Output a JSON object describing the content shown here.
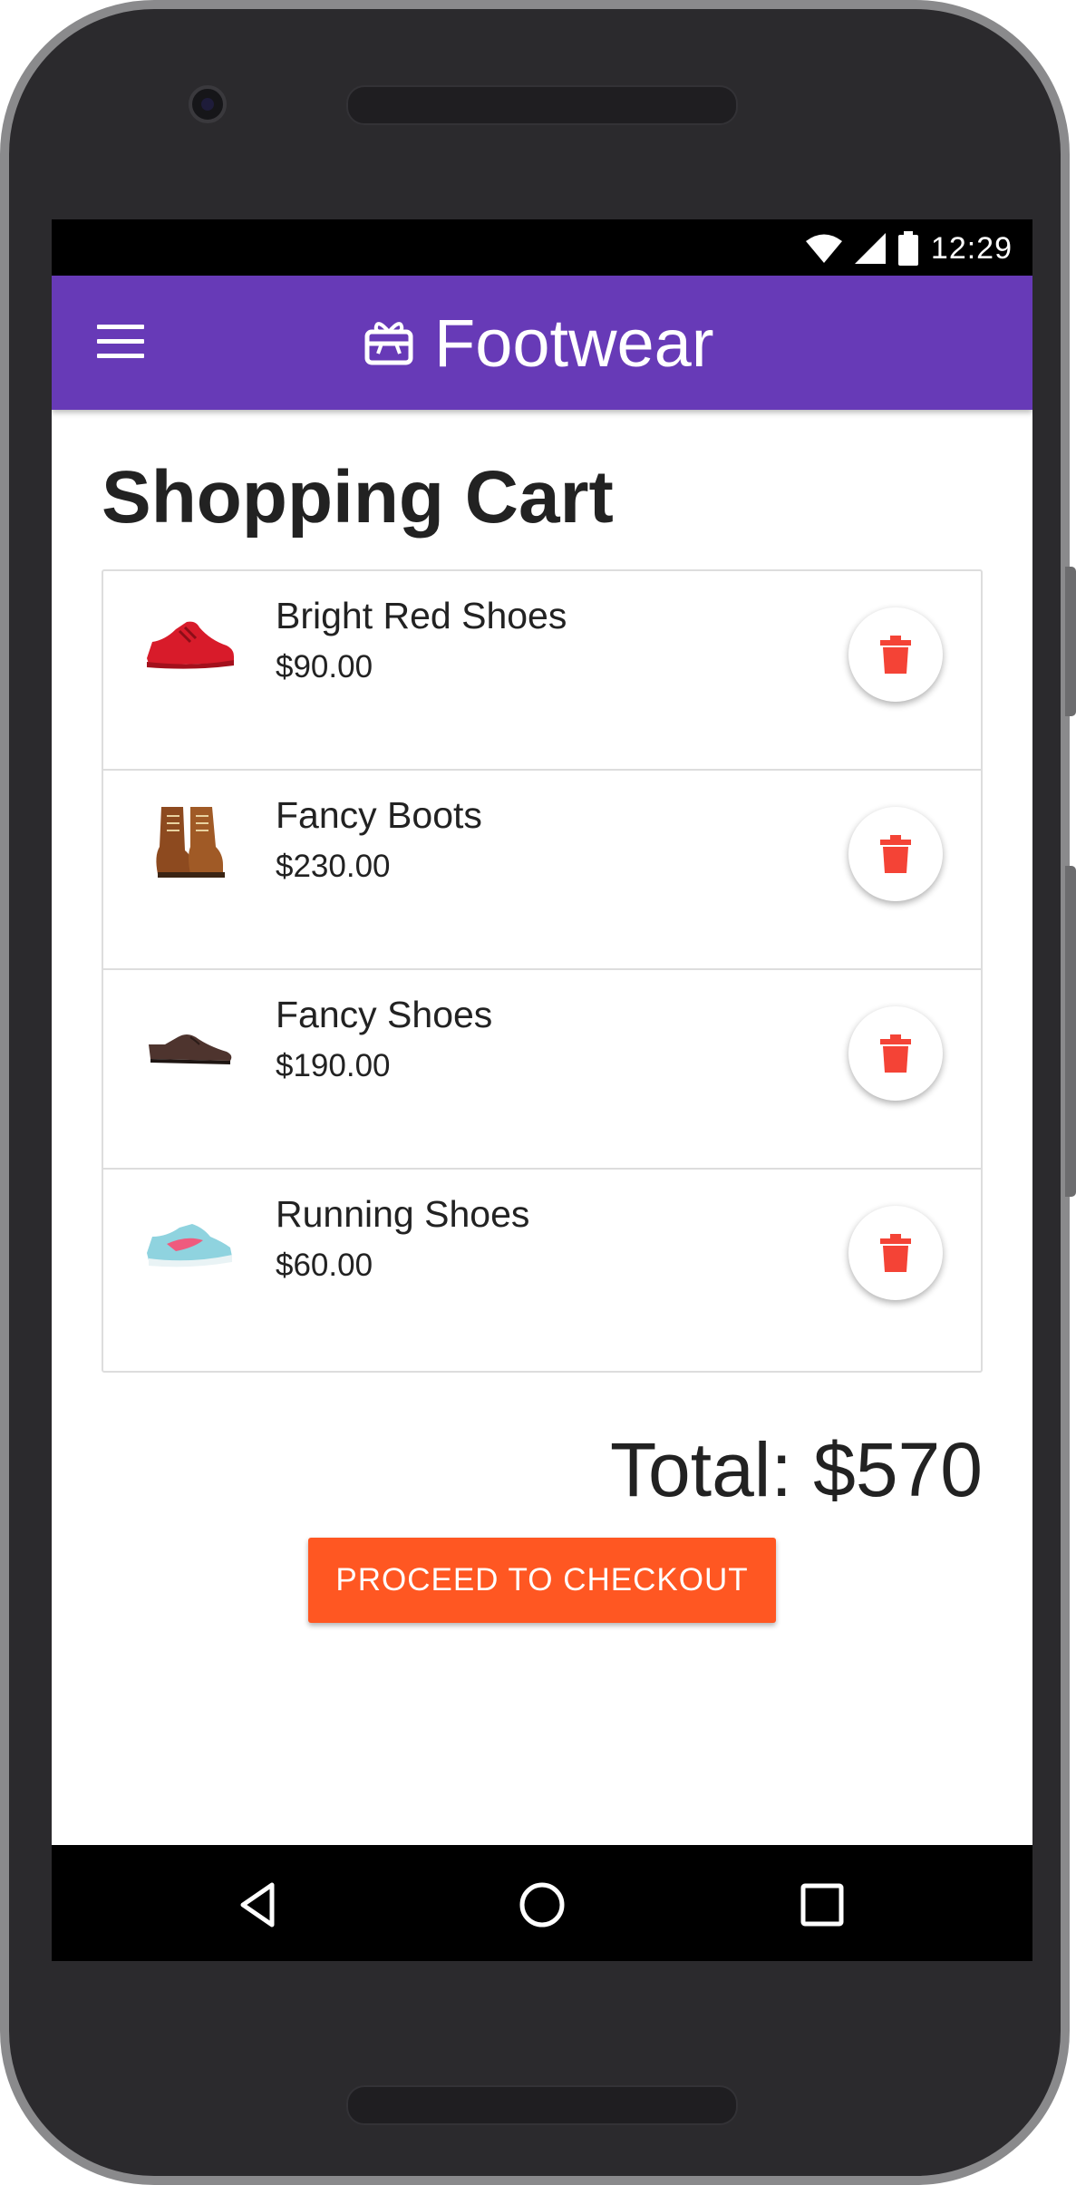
{
  "status_bar": {
    "time": "12:29"
  },
  "app_bar": {
    "title": "Footwear"
  },
  "page": {
    "title": "Shopping Cart"
  },
  "cart": {
    "items": [
      {
        "name": "Bright Red Shoes",
        "price": "$90.00"
      },
      {
        "name": "Fancy Boots",
        "price": "$230.00"
      },
      {
        "name": "Fancy Shoes",
        "price": "$190.00"
      },
      {
        "name": "Running Shoes",
        "price": "$60.00"
      }
    ],
    "total": "Total: $570",
    "checkout_label": "PROCEED TO CHECKOUT"
  },
  "colors": {
    "app_bar": "#673ab7",
    "checkout": "#ff5722",
    "delete_icon": "#f44336"
  },
  "icons": {
    "menu": "menu-icon",
    "brand": "gift-card-icon",
    "delete": "trash-icon",
    "nav_back": "back-icon",
    "nav_home": "home-icon",
    "nav_recents": "recents-icon"
  }
}
